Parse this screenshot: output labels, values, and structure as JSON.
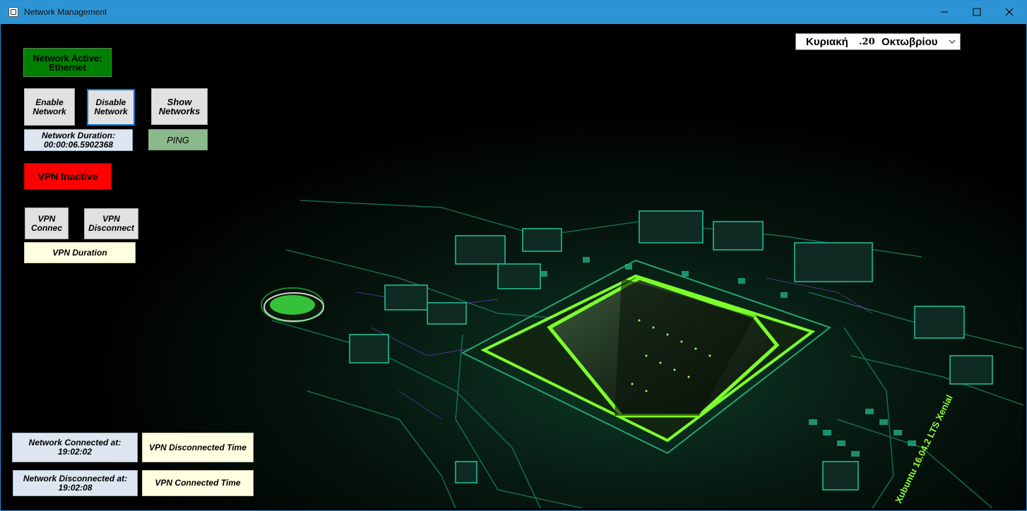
{
  "window": {
    "title": "Network Management",
    "controls": {
      "minimize": "–",
      "maximize": "□",
      "close": "✕"
    }
  },
  "date_picker": {
    "day_name": "Κυριακή",
    "day_number": ".20",
    "month": "Οκτωβρίου"
  },
  "network": {
    "status_label": "Network Active: Ethernet",
    "status_color": "#008000",
    "enable_button": "Enable Network",
    "disable_button": "Disable Network",
    "show_networks_button": "Show Networks",
    "duration_label": "Network Duration: 00:00:06.5902368",
    "ping_button": "PING"
  },
  "vpn": {
    "status_label": "VPN Inactive",
    "status_color": "#ff0000",
    "connect_button": "VPN Connec",
    "disconnect_button": "VPN Disconnect",
    "duration_label": "VPN Duration"
  },
  "log": {
    "network_connected": "Network Connected at: 19:02:02",
    "vpn_disconnected": "VPN Disconnected Time",
    "network_disconnected": "Network Disconnected at: 19:02:08",
    "vpn_connected": "VPN Connected Time"
  },
  "background": {
    "os_label": "Xubuntu 16.04.2 LTS Xenial",
    "accent": "#7dff2a",
    "trace": "#1fbf95"
  }
}
